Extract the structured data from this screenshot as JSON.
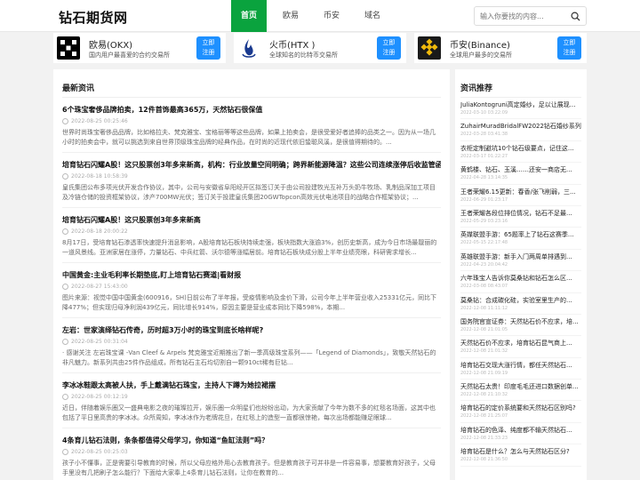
{
  "header": {
    "logo": "钻石期货网",
    "nav": [
      "首页",
      "欧易",
      "币安",
      "域名"
    ],
    "search_placeholder": "输入你要找的内容..."
  },
  "exchanges": [
    {
      "name": "欧易(OKX)",
      "desc": "国内用户最喜爱的合约交易所",
      "btn": "立即\n注册",
      "logo_color": "#000000"
    },
    {
      "name": "火币(HTX )",
      "desc": "全球知名的比特币交易所",
      "btn": "立即\n注册",
      "logo_color": "#1f6feb"
    },
    {
      "name": "币安(Binance)",
      "desc": "全球用户最多的交易所",
      "btn": "立即\n注册",
      "logo_color": "#1a1a1a"
    }
  ],
  "main": {
    "title": "最新资讯",
    "articles": [
      {
        "title": "6个珠宝奢侈品牌拍卖，12件首饰最高365万，天然钻石很保值",
        "time": "2022-08-25 00:25:46",
        "summary": "世界时尚珠宝奢侈品品牌，比如格拉夫、梵克雅宝、宝格丽等等这些品牌，如果上拍卖会，是很受爱好者追捧的品类之一。因为从一场几小时的拍卖会中，就可以挑选到来自世界顶级珠宝品牌的经典作品，在时尚的近现代依旧蛰聪风溪，是很值得期待的。..."
      },
      {
        "title": "培育钻石闪耀A股！这只股票创3年多来新高，机构：行业放量空间明确；跨界新能源降温？这些公司连续涨停后收监管函",
        "time": "2022-08-18 10:58:39",
        "summary": "皇氏集团公布多项光伏开发合作协议，其中，公司与安徽省阜阳经开区拟签订关于由公司投建牧光互补万头奶牛牧场、乳制品深加工项目及冷链仓储的投资框架协议，涉产700MW光伏；签订关于投建皇氏集团20GWTopcon高效光伏电池项目的战略合作框架协议；..."
      },
      {
        "title": "培育钻石闪耀A股！这只股票创3年多来新高",
        "time": "2022-08-18 20:00:22",
        "summary": "8月17日，受培育钻石渗透率快速提升消息影响，A股培育钻石板块持续走强，板块指数大涨逾3%，创历史新高，成为今日市场最靓丽的一道风景线。亚洲家居在涨停，力量钻石、中兵红箭、沃尔德等涨幅居前。培育钻石板块成分股上半年业绩亮眼，科研需求增长..."
      },
      {
        "title": "中国黄金:主业毛利率长期垫底,盯上培育钻石赛道|看财报",
        "time": "2022-08-27 15:43:00",
        "summary": "图片来源：视觉中国中国黄金(600916，SH)日前公布了半年报，受疫情影响及金价下滑，公司今年上半年营业收入25331亿元，同比下降477%；但实现归母净利润439亿元，同比增长914%，原因主要是营业成本同比下降598%，本期..."
      },
      {
        "title": "左岩：世家演绎钻石传奇，历时超3万小时的珠宝到底长啥样呢?",
        "time": "2022-08-25 00:31:04",
        "summary": "· 感谢关注 左岩珠宝课 -Van Cleef & Arpels 梵克雅宝近期推出了新一季高级珠宝系列——「Legend of Diamonds」，致敬天然钻石的非凡魅力。新系列共由25件作品组成，所有钻石主石均切割自一颗910ct稀有巨钻..."
      },
      {
        "title": "李冰冰鞋跟太高被人扶，手上戴满钻石珠宝，主持人下蹲为她拉裙摆",
        "time": "2022-08-25 00:12:19",
        "summary": "近日，伴随着娱乐圈又一盛典电影之夜的璀璨拉开，娱乐圈一众明星们也纷纷出动，为大家贡献了今年为数不多的红毯名场面，这其中也包括了平日里高贵的李冰冰。众所周知，李冰冰作为老牌花旦，在红毯上的造型一直都很惊艳，每次出场都能赚足眼球..."
      },
      {
        "title": "4条育儿钻石法则，条条都值得父母学习，你知道“鱼缸法则”吗？",
        "time": "2022-08-25 00:25:03",
        "summary": "孩子小不懂事，正是需要引导教育的时候，所以父母应格外用心去教育孩子。但是教育孩子可并非是一件容易事，想要教育好孩子，父母手里没有几把刷子怎么能行？下面给大家奉上4条育儿钻石法则，让你在教育的..."
      }
    ]
  },
  "sidebar": {
    "title": "资讯推荐",
    "items": [
      {
        "title": "JuliaKontogruni高定婚纱，足以让展现...",
        "time": "2022-03-10 03:22:09"
      },
      {
        "title": "ZuhairMuradBridalFW2022钻石婚纱系列",
        "time": "2022-03-28 03:41:38"
      },
      {
        "title": "衣柜定制避坑10个钻石级要点，记住这...",
        "time": "2022-03-17 01:22:27"
      },
      {
        "title": "黄鹤楼、钻石、玉溪……还安一商店无...",
        "time": "2022-04-28 13:14:35"
      },
      {
        "title": "王者荣耀6.15更新：春香/张飞削弱，三...",
        "time": "2022-06-29 01:23:17"
      },
      {
        "title": "王者荣耀各段位排位情况，钻石不足最...",
        "time": "2022-05-29 03:23:16"
      },
      {
        "title": "英媒联盟手游：65题率上了钻石这赛季...",
        "time": "2022-05-15 22:17:48"
      },
      {
        "title": "英雄联盟手游：新手入门两周单排遇到...",
        "time": "2022-04-23 20:04:42"
      },
      {
        "title": "六年珠宝人告诉你莫桑钻和钻石怎么区...",
        "time": "2022-03-08 08:43:07"
      },
      {
        "title": "莫桑钻：合成碳化硅，实验室里生产的...",
        "time": "2022-12-08 11:11:12"
      },
      {
        "title": "国务院官宣证券：天然钻石价不应求，培...",
        "time": "2022-12-08 21:01:05"
      },
      {
        "title": "天然钻石价不应求，培育钻石昆气商上...",
        "time": "2022-12-08 21:01:32"
      },
      {
        "title": "培育钻石交现大涨行情，都任天然钻石...",
        "time": "2022-12-08 21:09:19"
      },
      {
        "title": "天然钻石太贵！印度毛毛还进口数据创单...",
        "time": "2022-12-08 21:10:32"
      },
      {
        "title": "培育钻石的定价系统要和天然钻石区别吗?",
        "time": "2022-12-08 21:25:07"
      },
      {
        "title": "培育钻石的色泽、纯度都不输天然钻石...",
        "time": "2022-12-08 21:33:23"
      },
      {
        "title": "培育钻石是什么？怎么与天然钻石区分?",
        "time": "2022-12-08 21:36:50"
      }
    ]
  }
}
